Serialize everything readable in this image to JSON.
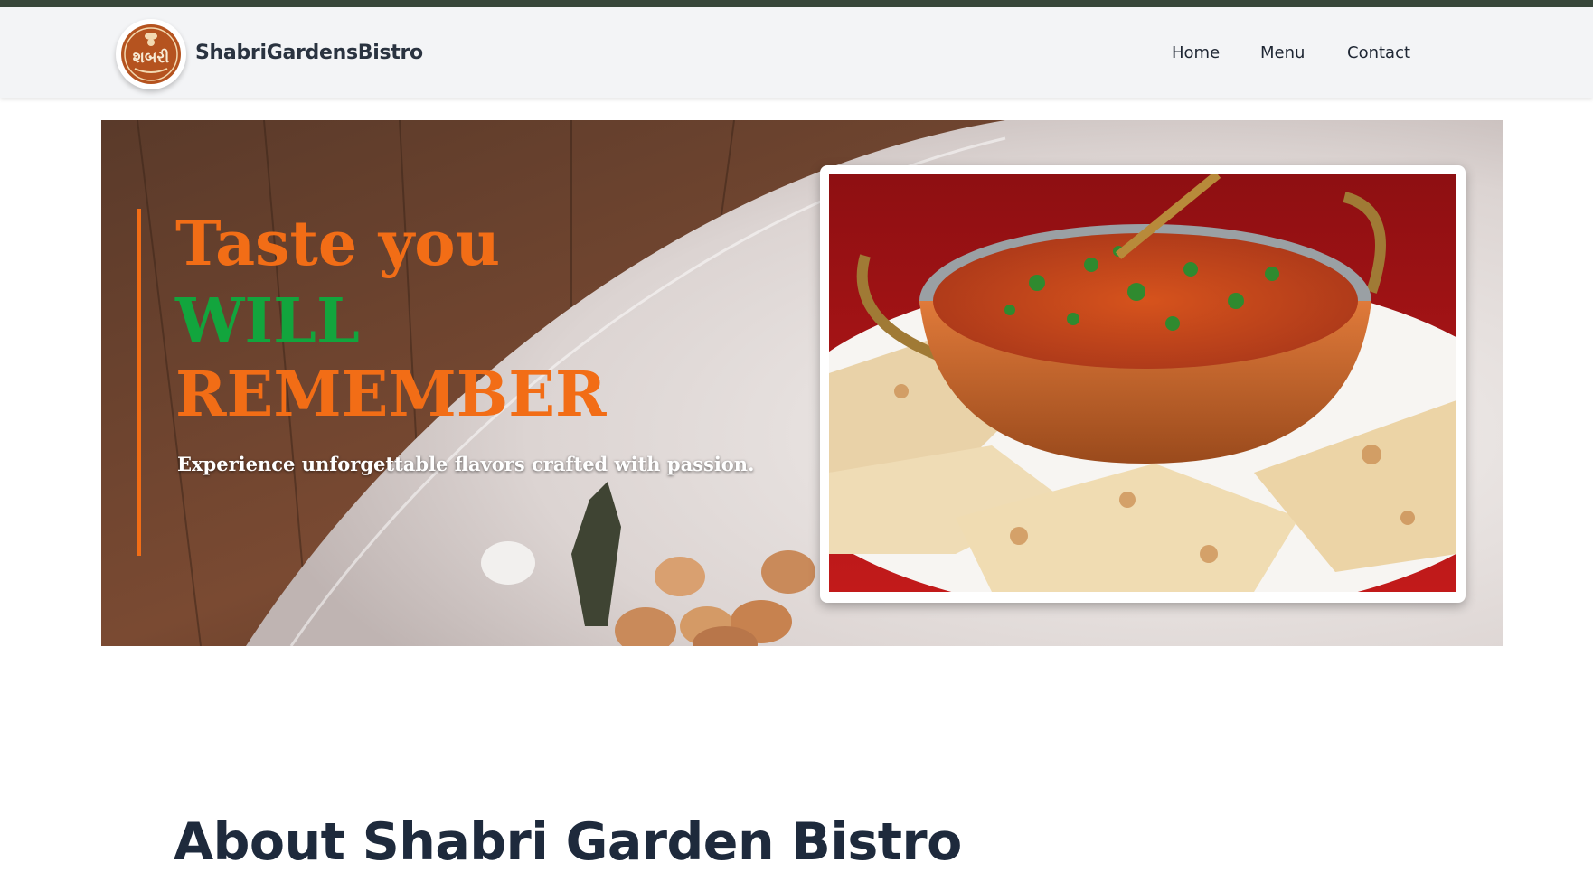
{
  "header": {
    "brand": "ShabriGardensBistro",
    "logo_text": "શબરી",
    "nav": [
      {
        "label": "Home"
      },
      {
        "label": "Menu"
      },
      {
        "label": "Contact"
      }
    ]
  },
  "hero": {
    "heading_line1": "Taste you",
    "heading_line2": "WILL",
    "heading_line3": "REMEMBER",
    "tagline": "Experience unforgettable flavors crafted with passion."
  },
  "about": {
    "title": "About Shabri Garden Bistro"
  },
  "colors": {
    "accent_orange": "#f26d16",
    "accent_green": "#12a53d",
    "topbar": "#38473a",
    "navbar_bg": "#f3f4f6",
    "heading_dark": "#1e2a3c"
  }
}
